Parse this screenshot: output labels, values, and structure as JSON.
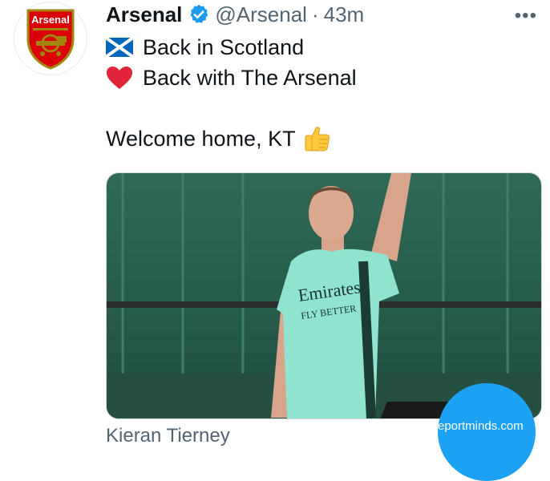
{
  "tweet": {
    "author": {
      "display_name": "Arsenal",
      "handle": "@Arsenal",
      "separator": "·",
      "time": "43m",
      "verified": true,
      "avatar_crest_text": "Arsenal"
    },
    "more_icon": "•••",
    "lines": [
      {
        "emoji": "scotland-flag-icon",
        "text": "Back in Scotland"
      },
      {
        "emoji": "red-heart-icon",
        "text": "Back with The Arsenal"
      },
      {
        "emoji": "thumbs-up-icon",
        "text": "Welcome home, KT"
      }
    ],
    "media": {
      "shirt_text_1": "Emirates",
      "shirt_text_2": "FLY BETTER",
      "tagged_person": "Kieran Tierney"
    }
  },
  "watermark": {
    "text": "reportminds.com"
  },
  "colors": {
    "link_blue": "#1d9bf0",
    "text": "#0f1419",
    "secondary": "#536471",
    "arsenal_red": "#db0007",
    "shirt": "#8fe3cf"
  }
}
